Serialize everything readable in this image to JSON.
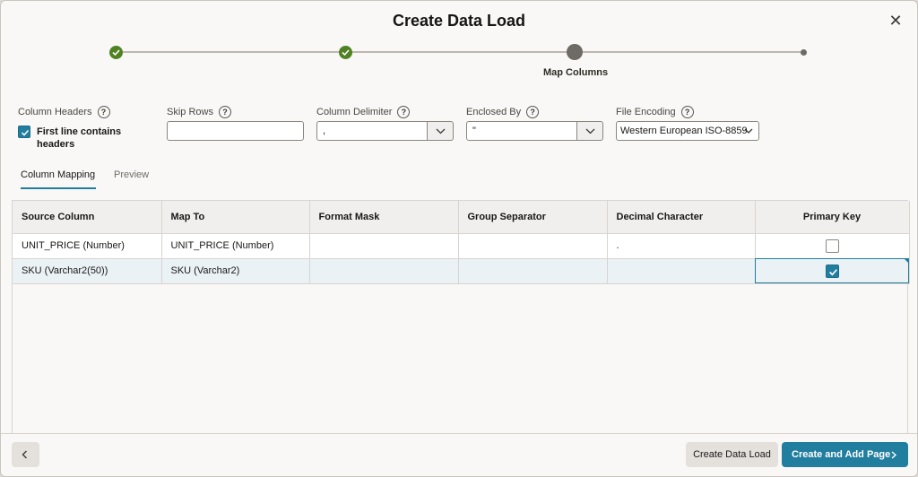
{
  "dialog": {
    "title": "Create Data Load",
    "close_glyph": "✕"
  },
  "stepper": {
    "steps": [
      {
        "state": "done"
      },
      {
        "state": "done"
      },
      {
        "state": "current",
        "label": "Map Columns"
      },
      {
        "state": "future"
      }
    ]
  },
  "options": {
    "column_headers": {
      "label": "Column Headers",
      "checked": true,
      "checkbox_text": "First line contains headers"
    },
    "skip_rows": {
      "label": "Skip Rows",
      "value": ""
    },
    "column_delimiter": {
      "label": "Column Delimiter",
      "value": ","
    },
    "enclosed_by": {
      "label": "Enclosed By",
      "value": "\""
    },
    "file_encoding": {
      "label": "File Encoding",
      "value": "Western European ISO-8859"
    },
    "help_glyph": "?"
  },
  "tabs": [
    {
      "label": "Column Mapping",
      "active": true
    },
    {
      "label": "Preview",
      "active": false
    }
  ],
  "grid": {
    "columns": [
      "Source Column",
      "Map To",
      "Format Mask",
      "Group Separator",
      "Decimal Character",
      "Primary Key"
    ],
    "rows": [
      {
        "source": "UNIT_PRICE (Number)",
        "map_to": "UNIT_PRICE (Number)",
        "format_mask": "",
        "group_separator": "",
        "decimal_character": ".",
        "primary_key": false
      },
      {
        "source": "SKU (Varchar2(50))",
        "map_to": "SKU (Varchar2)",
        "format_mask": "",
        "group_separator": "",
        "decimal_character": "",
        "primary_key": true
      }
    ]
  },
  "footer": {
    "create_data_load": "Create Data Load",
    "create_and_add_page": "Create and Add Page"
  },
  "colors": {
    "accent": "#227e9e",
    "done_step": "#508223"
  }
}
